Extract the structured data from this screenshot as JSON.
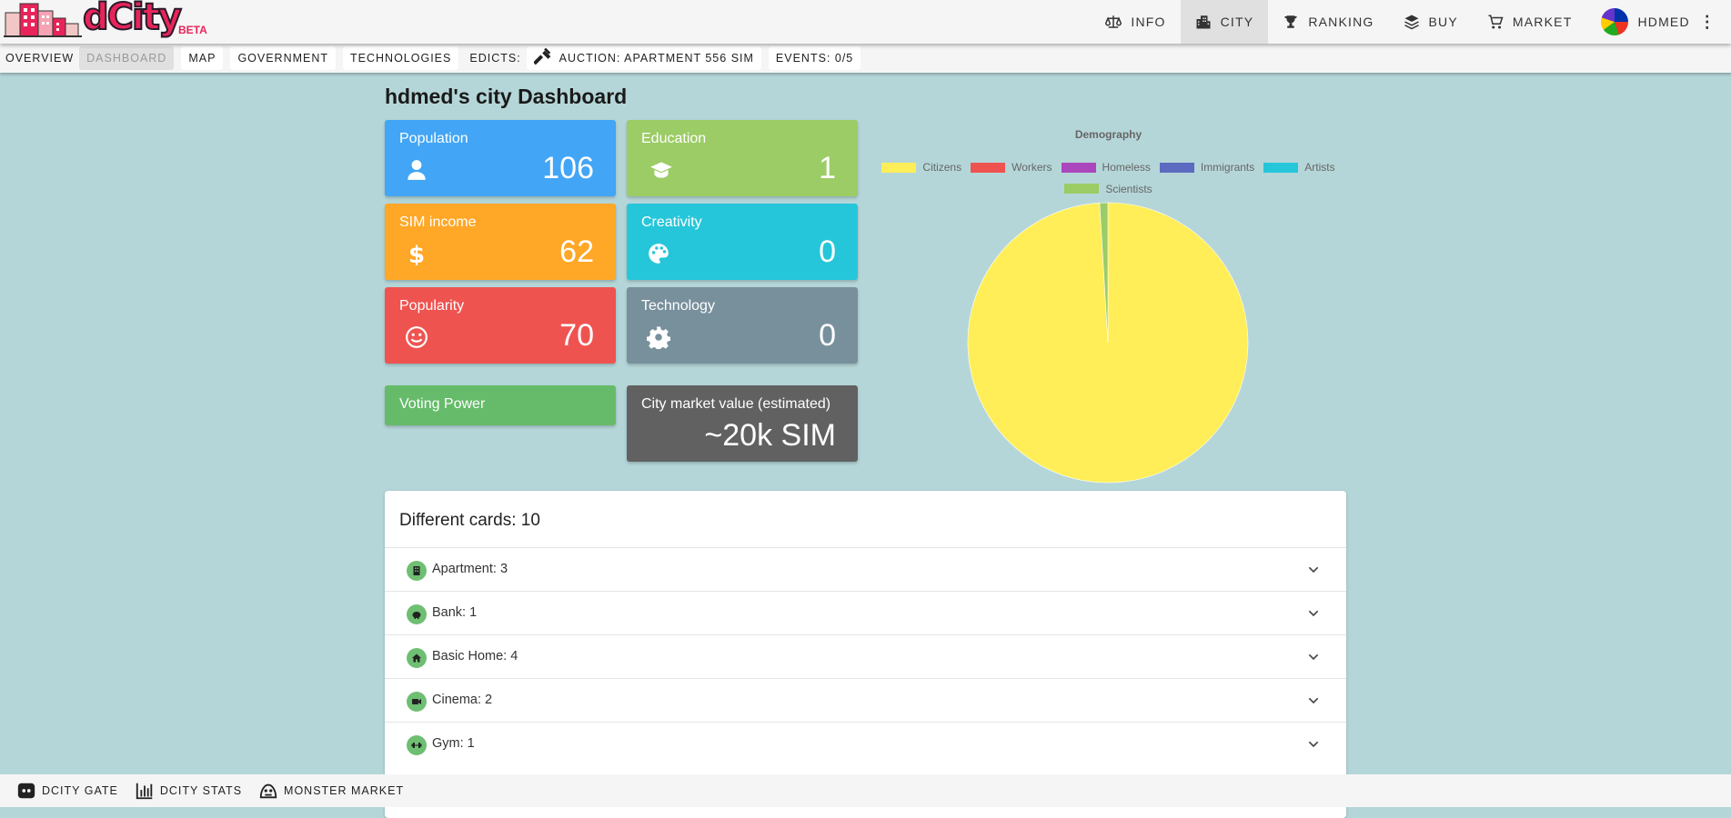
{
  "brand": {
    "logo_text": "dCity",
    "beta": "BETA"
  },
  "nav": {
    "items": [
      {
        "label": "INFO",
        "icon": "scale-icon"
      },
      {
        "label": "CITY",
        "icon": "city-icon",
        "active": true
      },
      {
        "label": "RANKING",
        "icon": "trophy-icon"
      },
      {
        "label": "BUY",
        "icon": "layers-icon"
      },
      {
        "label": "MARKET",
        "icon": "cart-icon"
      },
      {
        "label": "HDMED",
        "icon": "avatar"
      }
    ]
  },
  "subnav": {
    "overview": "OVERVIEW",
    "dashboard": "DASHBOARD",
    "map": "MAP",
    "government": "GOVERNMENT",
    "technologies": "TECHNOLOGIES",
    "edicts": "EDICTS:",
    "auction": "AUCTION: APARTMENT 556 SIM",
    "events": "EVENTS: 0/5"
  },
  "page": {
    "title": "hdmed's city Dashboard"
  },
  "tiles": {
    "population": {
      "label": "Population",
      "value": "106",
      "icon": "person-icon"
    },
    "education": {
      "label": "Education",
      "value": "1",
      "icon": "graduation-cap-icon"
    },
    "sim_income": {
      "label": "SIM income",
      "value": "62",
      "icon": "dollar-icon"
    },
    "creativity": {
      "label": "Creativity",
      "value": "0",
      "icon": "palette-icon"
    },
    "popularity": {
      "label": "Popularity",
      "value": "70",
      "icon": "smile-icon"
    },
    "technology": {
      "label": "Technology",
      "value": "0",
      "icon": "gear-icon"
    },
    "voting_power": {
      "label": "Voting Power"
    },
    "market_value": {
      "label": "City market value (estimated)",
      "value": "~20k SIM"
    }
  },
  "chart_data": {
    "type": "pie",
    "title": "Demography",
    "labels": [
      "Citizens",
      "Workers",
      "Homeless",
      "Immigrants",
      "Artists",
      "Scientists"
    ],
    "values": [
      105,
      0,
      0,
      0,
      0,
      1
    ],
    "colors": [
      "#ffee58",
      "#ef5350",
      "#ab47bc",
      "#5c6bc0",
      "#26c6da",
      "#9ccc65"
    ],
    "legend_position": "top"
  },
  "cards": {
    "title": "Different cards: 10",
    "items": [
      {
        "label": "Apartment: 3",
        "icon": "building-icon"
      },
      {
        "label": "Bank: 1",
        "icon": "piggy-bank-icon"
      },
      {
        "label": "Basic Home: 4",
        "icon": "home-icon"
      },
      {
        "label": "Cinema: 2",
        "icon": "video-camera-icon"
      },
      {
        "label": "Gym: 1",
        "icon": "dumbbell-icon"
      }
    ]
  },
  "footer": {
    "gate": "DCITY GATE",
    "stats": "DCITY STATS",
    "monster": "MONSTER MARKET"
  }
}
